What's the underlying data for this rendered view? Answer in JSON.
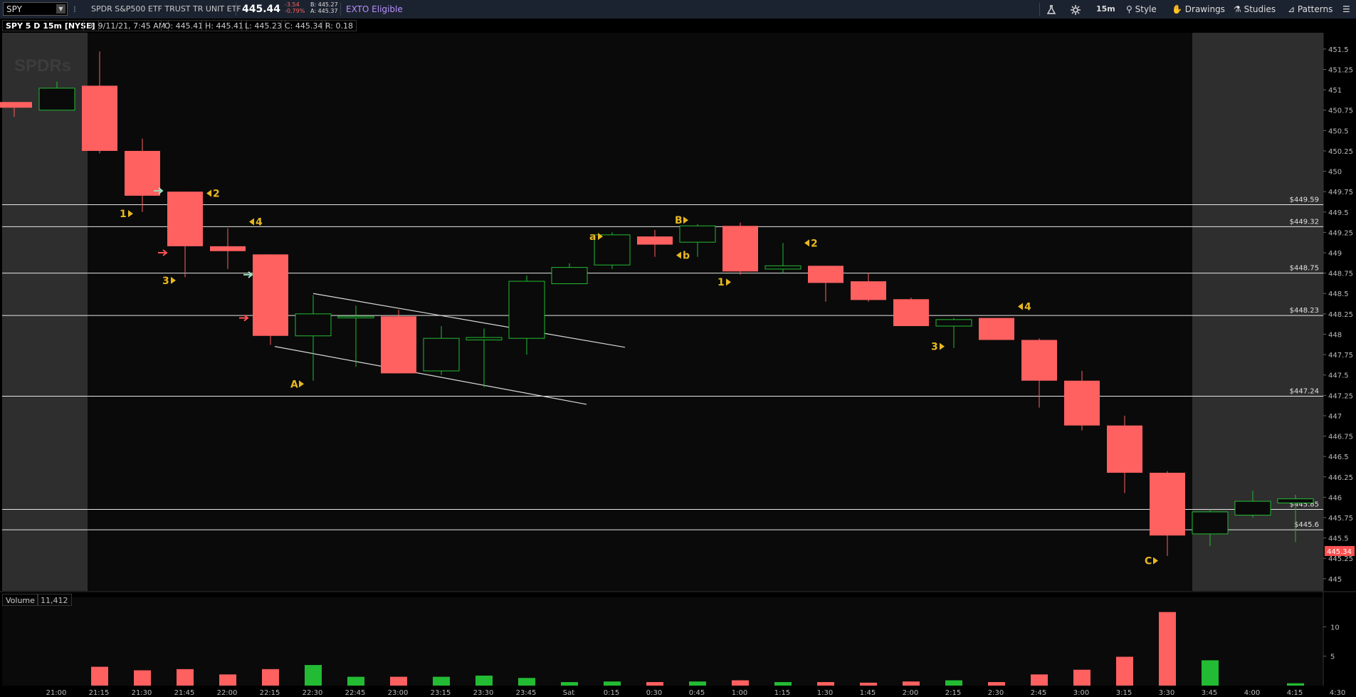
{
  "toolbar": {
    "symbol": "SPY",
    "description": "SPDR S&P500 ETF TRUST TR UNIT ETF",
    "last": "445.44",
    "change": "-3.54",
    "change_pct": "-0.79%",
    "bid": "B: 445.27",
    "ask": "A: 445.37",
    "exto": "EXTO Eligible",
    "interval": "15m",
    "style_label": "Style",
    "drawings_label": "Drawings",
    "studies_label": "Studies",
    "patterns_label": "Patterns"
  },
  "infobar": {
    "title": "SPY 5 D 15m [NYSE]",
    "date": "D: 9/11/21, 7:45 AM",
    "open": "O: 445.41",
    "high": "H: 445.41",
    "low": "L: 445.23",
    "close": "C: 445.34",
    "range": "R: 0.18"
  },
  "watermark": "SPDRs",
  "volume": {
    "label": "Volume",
    "value": "11,412"
  },
  "colors": {
    "up": "#22bb33",
    "down": "#ff6060",
    "annotation": "#e8b820",
    "level": "#e6e6e6"
  },
  "chart_data": {
    "type": "candlestick",
    "x_labels": [
      "21:00",
      "21:15",
      "21:30",
      "21:45",
      "22:00",
      "22:15",
      "22:30",
      "22:45",
      "23:00",
      "23:15",
      "23:30",
      "23:45",
      "Sat",
      "0:15",
      "0:30",
      "0:45",
      "1:00",
      "1:15",
      "1:30",
      "1:45",
      "2:00",
      "2:15",
      "2:30",
      "2:45",
      "3:00",
      "3:15",
      "3:30",
      "3:45",
      "4:00",
      "4:15",
      "4:30"
    ],
    "y_ticks": [
      "451.5",
      "451.25",
      "451",
      "450.75",
      "450.5",
      "450.25",
      "450",
      "449.75",
      "449.5",
      "449.25",
      "449",
      "448.75",
      "448.5",
      "448.25",
      "448",
      "447.75",
      "447.5",
      "447.25",
      "447",
      "446.75",
      "446.5",
      "446.25",
      "446",
      "445.75",
      "445.5",
      "445.25",
      "445"
    ],
    "ylim": [
      444.85,
      451.7
    ],
    "volume_ticks": [
      "10",
      "5"
    ],
    "volume_ylim": [
      0,
      15
    ],
    "candles": [
      {
        "o": 450.85,
        "h": 450.85,
        "l": 450.67,
        "c": 450.78
      },
      {
        "o": 450.75,
        "h": 451.1,
        "l": 450.75,
        "c": 451.02
      },
      {
        "o": 451.05,
        "h": 451.47,
        "l": 450.22,
        "c": 450.25
      },
      {
        "o": 450.25,
        "h": 450.4,
        "l": 449.5,
        "c": 449.7
      },
      {
        "o": 449.75,
        "h": 449.75,
        "l": 448.7,
        "c": 449.08
      },
      {
        "o": 449.08,
        "h": 449.3,
        "l": 448.8,
        "c": 449.02
      },
      {
        "o": 448.98,
        "h": 448.98,
        "l": 447.87,
        "c": 447.98
      },
      {
        "o": 447.98,
        "h": 448.48,
        "l": 447.43,
        "c": 448.25
      },
      {
        "o": 448.2,
        "h": 448.35,
        "l": 447.6,
        "c": 448.22
      },
      {
        "o": 448.22,
        "h": 448.3,
        "l": 447.52,
        "c": 447.52
      },
      {
        "o": 447.55,
        "h": 448.1,
        "l": 447.5,
        "c": 447.95
      },
      {
        "o": 447.93,
        "h": 448.07,
        "l": 447.35,
        "c": 447.96
      },
      {
        "o": 447.95,
        "h": 448.72,
        "l": 447.75,
        "c": 448.65
      },
      {
        "o": 448.62,
        "h": 448.87,
        "l": 448.62,
        "c": 448.82
      },
      {
        "o": 448.85,
        "h": 449.25,
        "l": 448.8,
        "c": 449.22
      },
      {
        "o": 449.2,
        "h": 449.28,
        "l": 448.95,
        "c": 449.1
      },
      {
        "o": 449.13,
        "h": 449.35,
        "l": 448.95,
        "c": 449.33
      },
      {
        "o": 449.33,
        "h": 449.37,
        "l": 448.73,
        "c": 448.77
      },
      {
        "o": 448.8,
        "h": 449.12,
        "l": 448.75,
        "c": 448.84
      },
      {
        "o": 448.84,
        "h": 448.84,
        "l": 448.4,
        "c": 448.63
      },
      {
        "o": 448.65,
        "h": 448.75,
        "l": 448.4,
        "c": 448.42
      },
      {
        "o": 448.43,
        "h": 448.45,
        "l": 448.1,
        "c": 448.1
      },
      {
        "o": 448.1,
        "h": 448.2,
        "l": 447.83,
        "c": 448.18
      },
      {
        "o": 448.2,
        "h": 448.2,
        "l": 447.93,
        "c": 447.93
      },
      {
        "o": 447.93,
        "h": 447.95,
        "l": 447.1,
        "c": 447.43
      },
      {
        "o": 447.43,
        "h": 447.55,
        "l": 446.82,
        "c": 446.88
      },
      {
        "o": 446.88,
        "h": 447.0,
        "l": 446.05,
        "c": 446.3
      },
      {
        "o": 446.3,
        "h": 446.32,
        "l": 445.28,
        "c": 445.53
      },
      {
        "o": 445.55,
        "h": 445.85,
        "l": 445.4,
        "c": 445.82
      },
      {
        "o": 445.78,
        "h": 446.08,
        "l": 445.75,
        "c": 445.95
      },
      {
        "o": 445.93,
        "h": 446.03,
        "l": 445.45,
        "c": 445.98
      }
    ],
    "volumes": [
      0,
      0,
      3.2,
      2.6,
      2.8,
      1.9,
      2.8,
      3.5,
      1.5,
      1.5,
      1.5,
      1.7,
      1.3,
      0.6,
      0.7,
      0.6,
      0.7,
      0.9,
      0.6,
      0.6,
      0.5,
      0.7,
      0.9,
      0.6,
      1.9,
      2.7,
      4.9,
      12.5,
      4.3,
      0,
      0.4
    ],
    "levels": [
      {
        "price": 449.59,
        "label": "$449.59"
      },
      {
        "price": 449.32,
        "label": "$449.32"
      },
      {
        "price": 448.75,
        "label": "$448.75"
      },
      {
        "price": 448.23,
        "label": "$448.23"
      },
      {
        "price": 447.24,
        "label": "$447.24"
      },
      {
        "price": 445.85,
        "label": "$445.85"
      },
      {
        "price": 445.6,
        "label": "$445.6"
      }
    ],
    "current_price_label": "445.34",
    "current_price": 445.34,
    "annotations": [
      {
        "text": "1",
        "dir": "right",
        "i": 3,
        "y": 449.48
      },
      {
        "text": "2",
        "dir": "left",
        "i": 4,
        "y": 449.73
      },
      {
        "text": "3",
        "dir": "right",
        "i": 4,
        "y": 448.66
      },
      {
        "text": "4",
        "dir": "left",
        "i": 5,
        "y": 449.38
      },
      {
        "text": "A",
        "dir": "right",
        "i": 7,
        "y": 447.39
      },
      {
        "text": "a",
        "dir": "right",
        "i": 14,
        "y": 449.2
      },
      {
        "text": "b",
        "dir": "left",
        "i": 15,
        "y": 448.97
      },
      {
        "text": "B",
        "dir": "right",
        "i": 16,
        "y": 449.4
      },
      {
        "text": "1",
        "dir": "right",
        "i": 17,
        "y": 448.64
      },
      {
        "text": "2",
        "dir": "left",
        "i": 18,
        "y": 449.12
      },
      {
        "text": "3",
        "dir": "right",
        "i": 22,
        "y": 447.85
      },
      {
        "text": "4",
        "dir": "left",
        "i": 23,
        "y": 448.34
      },
      {
        "text": "C",
        "dir": "right",
        "i": 27,
        "y": 445.22
      }
    ],
    "arrows": [
      {
        "color": "#ff5050",
        "i": 3.5,
        "y": 449.0
      },
      {
        "color": "#ff5050",
        "i": 5.4,
        "y": 448.2
      },
      {
        "color": "#9be0c0",
        "i": 3.4,
        "y": 449.76
      },
      {
        "color": "#9be0c0",
        "i": 5.5,
        "y": 448.73
      }
    ],
    "trendlines": [
      {
        "i1": 7,
        "y1": 448.5,
        "i2": 14.3,
        "y2": 447.84
      },
      {
        "i1": 6.1,
        "y1": 447.85,
        "i2": 13.4,
        "y2": 447.14
      }
    ]
  }
}
